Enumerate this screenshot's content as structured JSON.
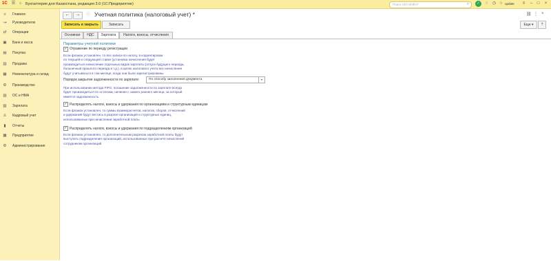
{
  "titlebar": {
    "logo": "1С",
    "app_title": "Бухгалтерия для Казахстана, редакция 3.0  (1С:Предприятие)",
    "search_placeholder": "Поиск Ctrl+Shift+F",
    "user": "update"
  },
  "sidebar": {
    "items": [
      {
        "label": "Главное",
        "icon": "menu-icon"
      },
      {
        "label": "Руководителю",
        "icon": "chart-line-icon"
      },
      {
        "label": "Операции",
        "icon": "operations-icon"
      },
      {
        "label": "Банк и касса",
        "icon": "bank-icon"
      },
      {
        "label": "Покупка",
        "icon": "cart-icon"
      },
      {
        "label": "Продажа",
        "icon": "sales-icon"
      },
      {
        "label": "Номенклатура и склад",
        "icon": "warehouse-icon"
      },
      {
        "label": "Производство",
        "icon": "production-icon"
      },
      {
        "label": "ОС и НМА",
        "icon": "assets-icon"
      },
      {
        "label": "Зарплата",
        "icon": "salary-icon"
      },
      {
        "label": "Кадровый учет",
        "icon": "personnel-icon"
      },
      {
        "label": "Отчеты",
        "icon": "reports-icon"
      },
      {
        "label": "Предприятие",
        "icon": "enterprise-icon"
      },
      {
        "label": "Администрирование",
        "icon": "admin-icon"
      }
    ]
  },
  "header": {
    "page_title": "Учетная политика (налоговый учет) *"
  },
  "toolbar": {
    "save_close_label": "Записать и закрыть",
    "save_label": "Записать",
    "more_label": "Еще",
    "help_label": "?"
  },
  "tabs": [
    {
      "label": "Основная",
      "active": false
    },
    {
      "label": "НДС",
      "active": false
    },
    {
      "label": "Зарплата",
      "active": true
    },
    {
      "label": "Налоги, взносы, отчисления",
      "active": false
    }
  ],
  "form": {
    "group_title": "Параметры учетной политики",
    "opt1": {
      "label": "Отражение по периоду регистрации",
      "checked": true,
      "hint": [
        "Если флажок установлен, то все записи по налогу, в корректировки",
        "по текущей и следующей ставке  (установка начисления будет",
        "производиться начисление отдельных видов зарплаты (отпуск будущего периода,",
        "больничный прошлого периода и т.д.), в целях налогового учета все начисления",
        "будут учитываться в том месяце, когда они были зарегистрированы"
      ]
    },
    "closing": {
      "label": "Порядок закрытия задолженности по зарплате:",
      "value": "По способу заполнения документа",
      "hint": [
        "При использовании метода FIFO, погашение задолженности по зарплате всегда",
        "будет производиться по остаткам, начиная с самого раннего месяца, за который",
        "имеется задолженность."
      ]
    },
    "opt2": {
      "label": "Распределять налоги, взносы и удержания по организациям и структурным единицам",
      "checked": true,
      "hint": [
        "Если флажок установлен, то суммы взаиморасчетов, налогов, сборов, отчислений",
        "и удержаний будут вестись в разрезе организаций и структурных единиц,",
        "использованных при начислении заработной платы"
      ]
    },
    "opt3": {
      "label": "Распределять налоги, взносы и удержания по подразделениям организаций",
      "checked": true,
      "hint": [
        "Если флажок установлен, то дополнительным разрезом заработной платы будут",
        "выступать подразделения организаций, использованные при расчете начислений",
        "сотрудникам организаций"
      ]
    }
  },
  "colors": {
    "titlebar": "#fbed9e",
    "sidebar": "#fbf1b9",
    "primary_button": "#fbe44e",
    "hint_text": "#4a4aa6",
    "group_title": "#2d7ba5"
  }
}
